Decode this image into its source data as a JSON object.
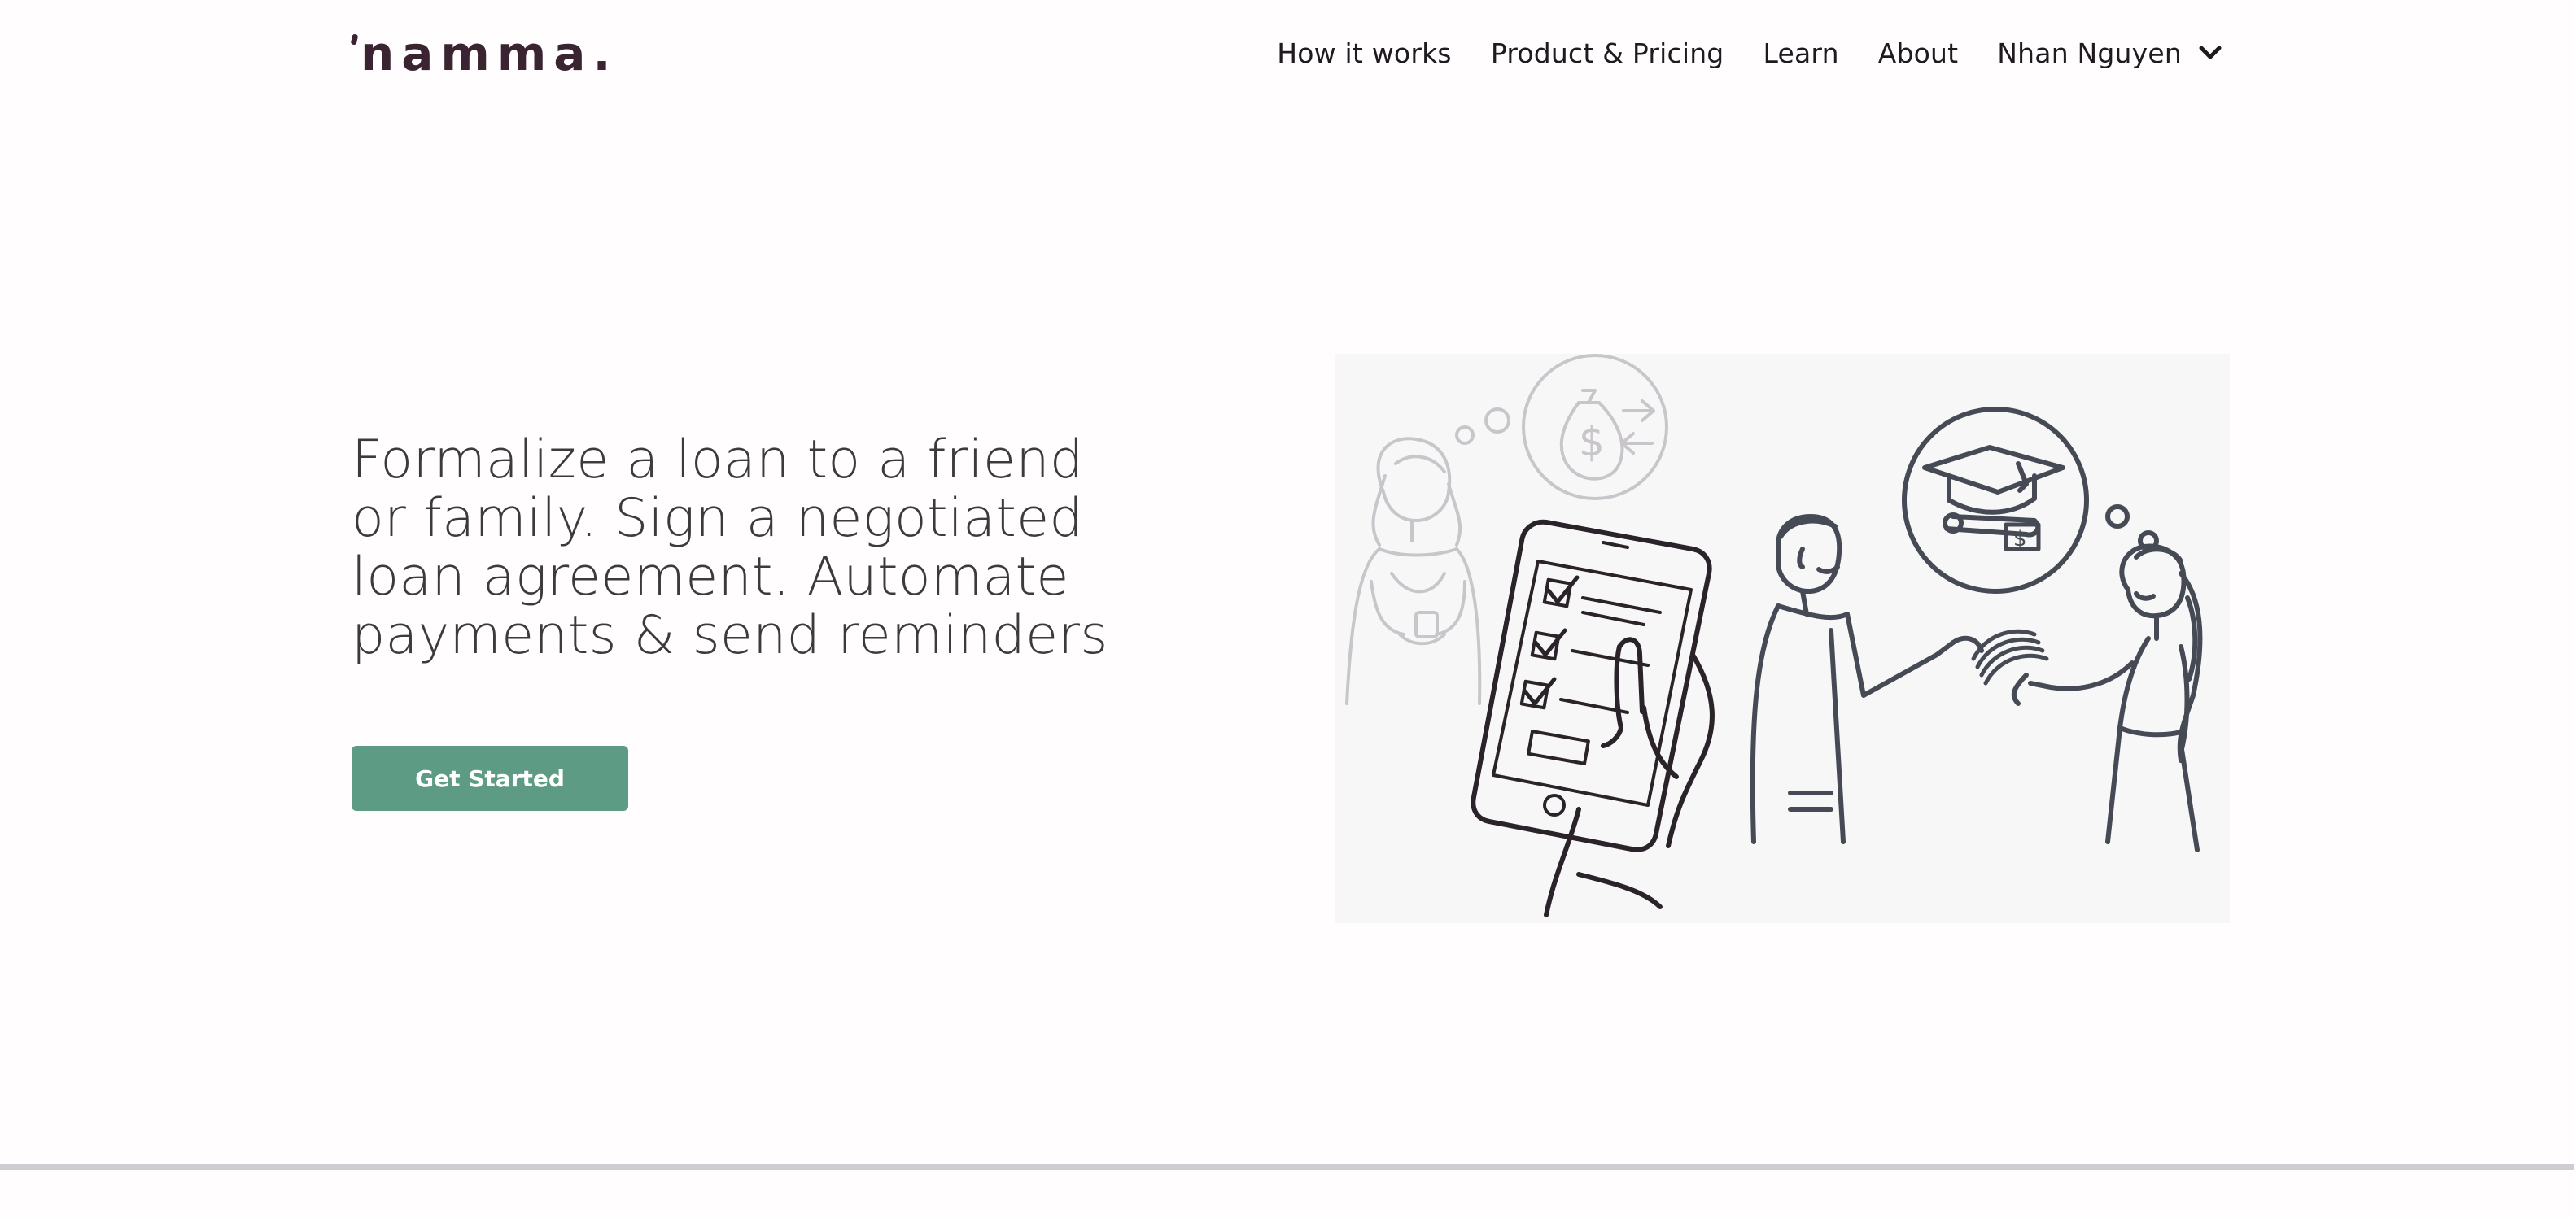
{
  "brand": {
    "logo_text": "namma.",
    "logo_color": "#3a2431"
  },
  "nav": {
    "items": [
      {
        "label": "How it works"
      },
      {
        "label": "Product & Pricing"
      },
      {
        "label": "Learn"
      },
      {
        "label": "About"
      }
    ],
    "user": {
      "name": "Nhan Nguyen",
      "icon": "chevron-down-icon"
    }
  },
  "hero": {
    "headline": "Formalize a loan to a friend or family. Sign a negotiated loan agreement. Automate payments & send reminders",
    "cta_label": "Get Started",
    "cta_color": "#5d9b85",
    "illustration_icon": "loan-illustration"
  }
}
